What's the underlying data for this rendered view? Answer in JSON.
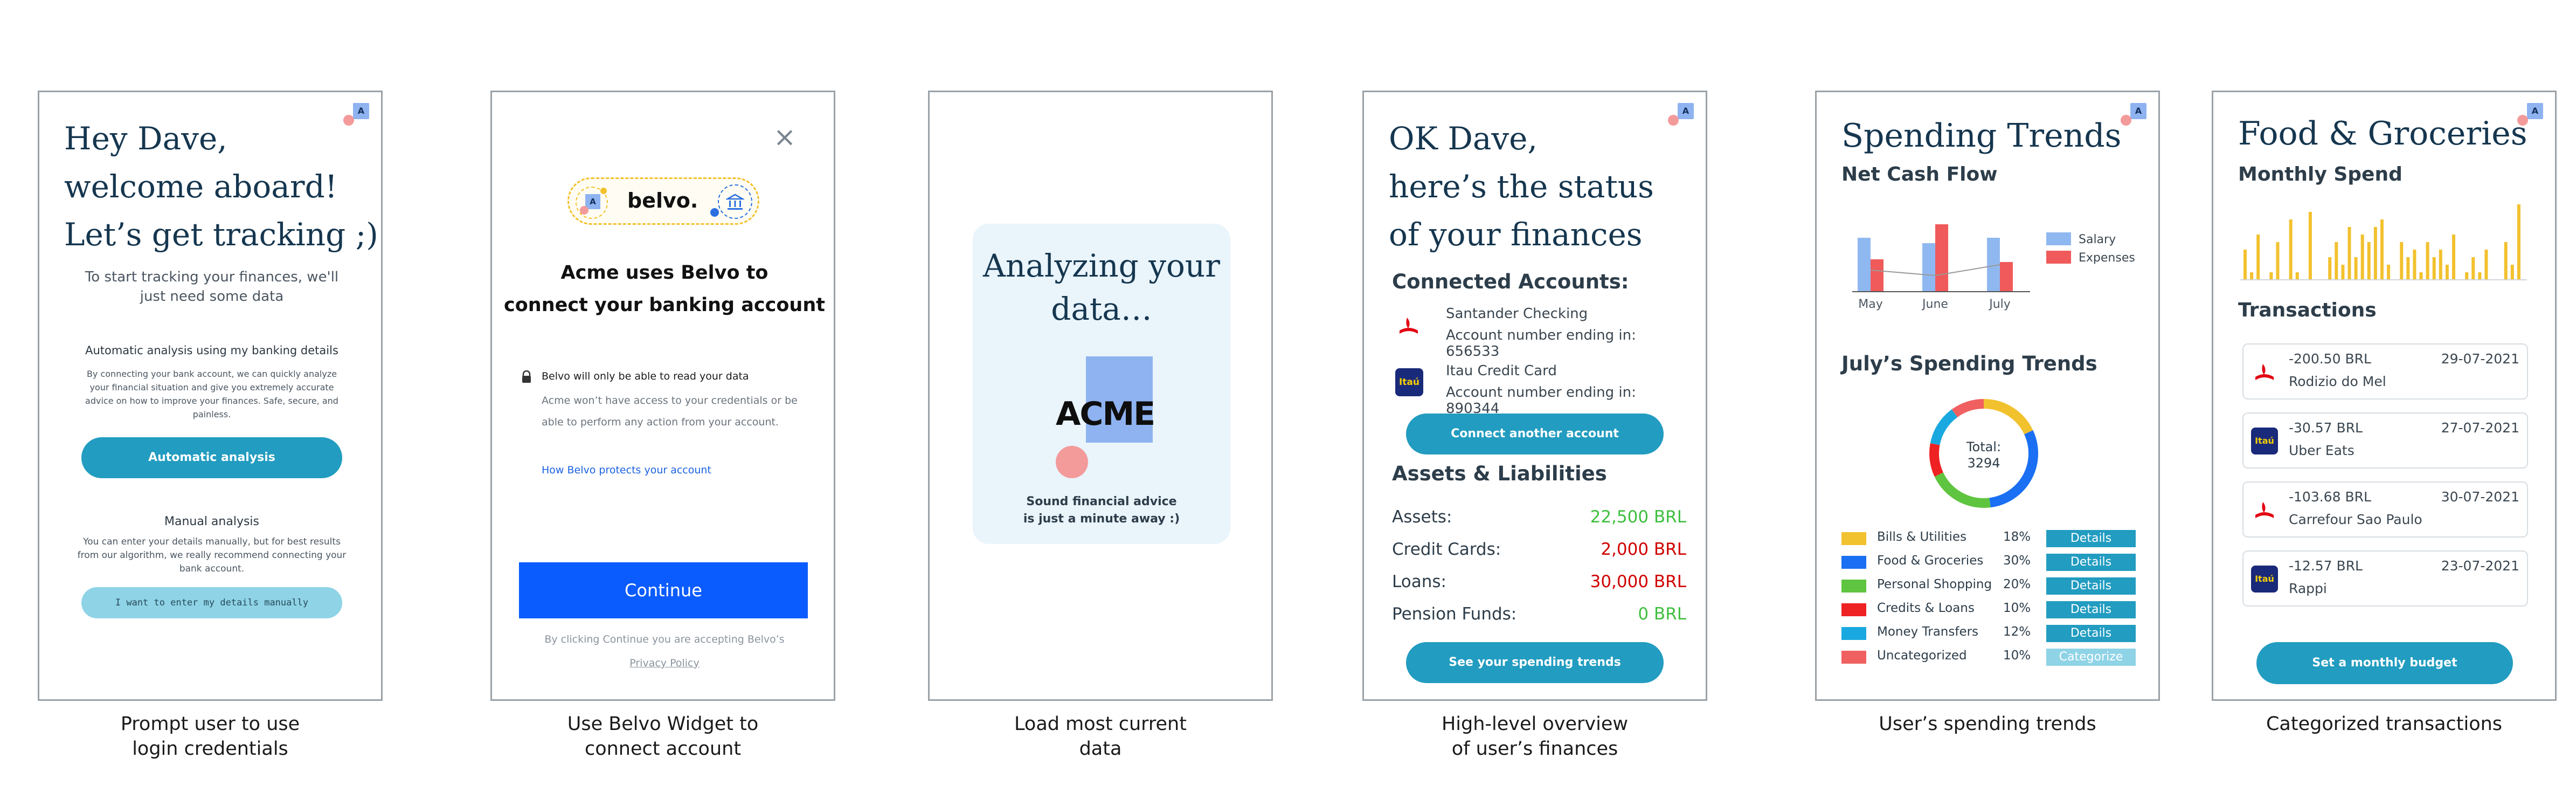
{
  "screen1": {
    "greeting": [
      "Hey Dave,",
      "welcome aboard!",
      "Let’s get tracking ;)"
    ],
    "intro": "To start tracking your finances, we'll just need some data",
    "auto_title": "Automatic analysis using my banking details",
    "auto_desc": "By connecting your bank account, we can quickly analyze your financial situation and give you extremely accurate advice on how to improve your finances. Safe, secure, and painless.",
    "auto_button": "Automatic analysis",
    "manual_title": "Manual analysis",
    "manual_desc": "You can enter your details manually, but for best results from our algorithm, we really recommend connecting your bank account.",
    "manual_button": "I want to enter my details manually",
    "caption": [
      "Prompt user to use",
      "login credentials"
    ]
  },
  "screen2": {
    "close_glyph": "×",
    "brand": "belvo.",
    "title": [
      "Acme uses Belvo to",
      "connect your banking account"
    ],
    "read_note": "Belvo will only be able to read your data",
    "read_desc": "Acme won’t have access to your credentials or be able to perform any action from your account.",
    "protect_link": "How Belvo protects your account",
    "continue_button": "Continue",
    "terms": "By clicking Continue you are accepting Belvo’s",
    "privacy_link": "Privacy Policy",
    "caption": [
      "Use Belvo Widget to",
      "connect account"
    ]
  },
  "screen3": {
    "title": [
      "Analyzing your",
      "data…"
    ],
    "brand": "ACME",
    "tagline": [
      "Sound financial advice",
      "is just a minute away :)"
    ],
    "caption": [
      "Load most current",
      "data"
    ]
  },
  "screen4": {
    "heading": [
      "OK Dave,",
      "here’s the status",
      "of your finances"
    ],
    "connected_title": "Connected Accounts:",
    "accounts": [
      {
        "name": "Santander Checking",
        "number": "Account number ending in: 656533",
        "icon": "santander-logo-icon"
      },
      {
        "name": "Itau Credit Card",
        "number": "Account number ending in: 890344",
        "icon": "itau-logo-icon"
      }
    ],
    "itau_label": "Itaú",
    "connect_button": "Connect another account",
    "assets_title": "Assets & Liabilities",
    "rows": [
      {
        "label": "Assets:",
        "value": "22,500 BRL",
        "color": "#3fbf3f"
      },
      {
        "label": "Credit Cards:",
        "value": "2,000 BRL",
        "color": "#d00000"
      },
      {
        "label": "Loans:",
        "value": "30,000 BRL",
        "color": "#d00000"
      },
      {
        "label": "Pension Funds:",
        "value": "0 BRL",
        "color": "#3fbf3f"
      }
    ],
    "trends_button": "See your spending trends",
    "caption": [
      "High-level overview",
      "of user’s finances"
    ]
  },
  "screen5": {
    "title": "Spending Trends",
    "net_title": "Net Cash Flow",
    "chart_data": [
      {
        "type": "bar",
        "categories": [
          "May",
          "June",
          "July"
        ],
        "series": [
          {
            "name": "Salary",
            "values": [
              100,
              90,
              100
            ],
            "color": "#90b8f0"
          },
          {
            "name": "Expenses",
            "values": [
              60,
              125,
              55
            ],
            "color": "#f05a5a"
          }
        ],
        "ylim": [
          0,
          130
        ]
      },
      {
        "type": "pie",
        "categories": [
          "Bills & Utilities",
          "Food & Groceries",
          "Personal Shopping",
          "Credits & Loans",
          "Money Transfers",
          "Uncategorized"
        ],
        "values": [
          18,
          30,
          20,
          10,
          12,
          10
        ],
        "colors": [
          "#f2c12e",
          "#1a6ff2",
          "#5fc43f",
          "#ee2222",
          "#1aa8e0",
          "#f06060"
        ],
        "center_label": [
          "Total:",
          "3294"
        ]
      }
    ],
    "july_title": "July’s Spending Trends",
    "categories": [
      {
        "label": "Bills & Utilities",
        "pct": "18%",
        "color": "#f2c12e",
        "action": "Details"
      },
      {
        "label": "Food & Groceries",
        "pct": "30%",
        "color": "#1a6ff2",
        "action": "Details"
      },
      {
        "label": "Personal Shopping",
        "pct": "20%",
        "color": "#5fc43f",
        "action": "Details"
      },
      {
        "label": "Credits & Loans",
        "pct": "10%",
        "color": "#ee2222",
        "action": "Details"
      },
      {
        "label": "Money Transfers",
        "pct": "12%",
        "color": "#1aa8e0",
        "action": "Details"
      },
      {
        "label": "Uncategorized",
        "pct": "10%",
        "color": "#f06060",
        "action": "Categorize"
      }
    ],
    "caption": [
      "User’s spending trends"
    ]
  },
  "screen6": {
    "title": "Food & Groceries",
    "monthly_title": "Monthly Spend",
    "chart_data": {
      "type": "bar",
      "values": [
        4,
        1,
        6,
        0,
        1,
        5,
        0,
        8,
        1,
        0,
        9,
        0,
        0,
        3,
        5,
        2,
        7,
        3,
        6,
        5,
        7,
        8,
        2,
        0,
        5,
        3,
        4,
        1,
        5,
        3,
        4,
        2,
        6,
        0,
        1,
        3,
        1,
        4,
        0,
        0,
        5,
        2,
        10
      ],
      "color": "#f2c12e",
      "ylim": [
        0,
        10
      ]
    },
    "transactions_title": "Transactions",
    "transactions": [
      {
        "amount": "-200.50 BRL",
        "date": "29-07-2021",
        "merchant": "Rodizio do Mel",
        "icon": "santander-logo-icon"
      },
      {
        "amount": "-30.57 BRL",
        "date": "27-07-2021",
        "merchant": "Uber Eats",
        "icon": "itau-logo-icon"
      },
      {
        "amount": "-103.68 BRL",
        "date": "30-07-2021",
        "merchant": "Carrefour Sao Paulo",
        "icon": "santander-logo-icon"
      },
      {
        "amount": "-12.57 BRL",
        "date": "23-07-2021",
        "merchant": "Rappi",
        "icon": "itau-logo-icon"
      }
    ],
    "budget_button": "Set a monthly budget",
    "caption": [
      "Categorized transactions"
    ]
  },
  "badge_letter": "A"
}
